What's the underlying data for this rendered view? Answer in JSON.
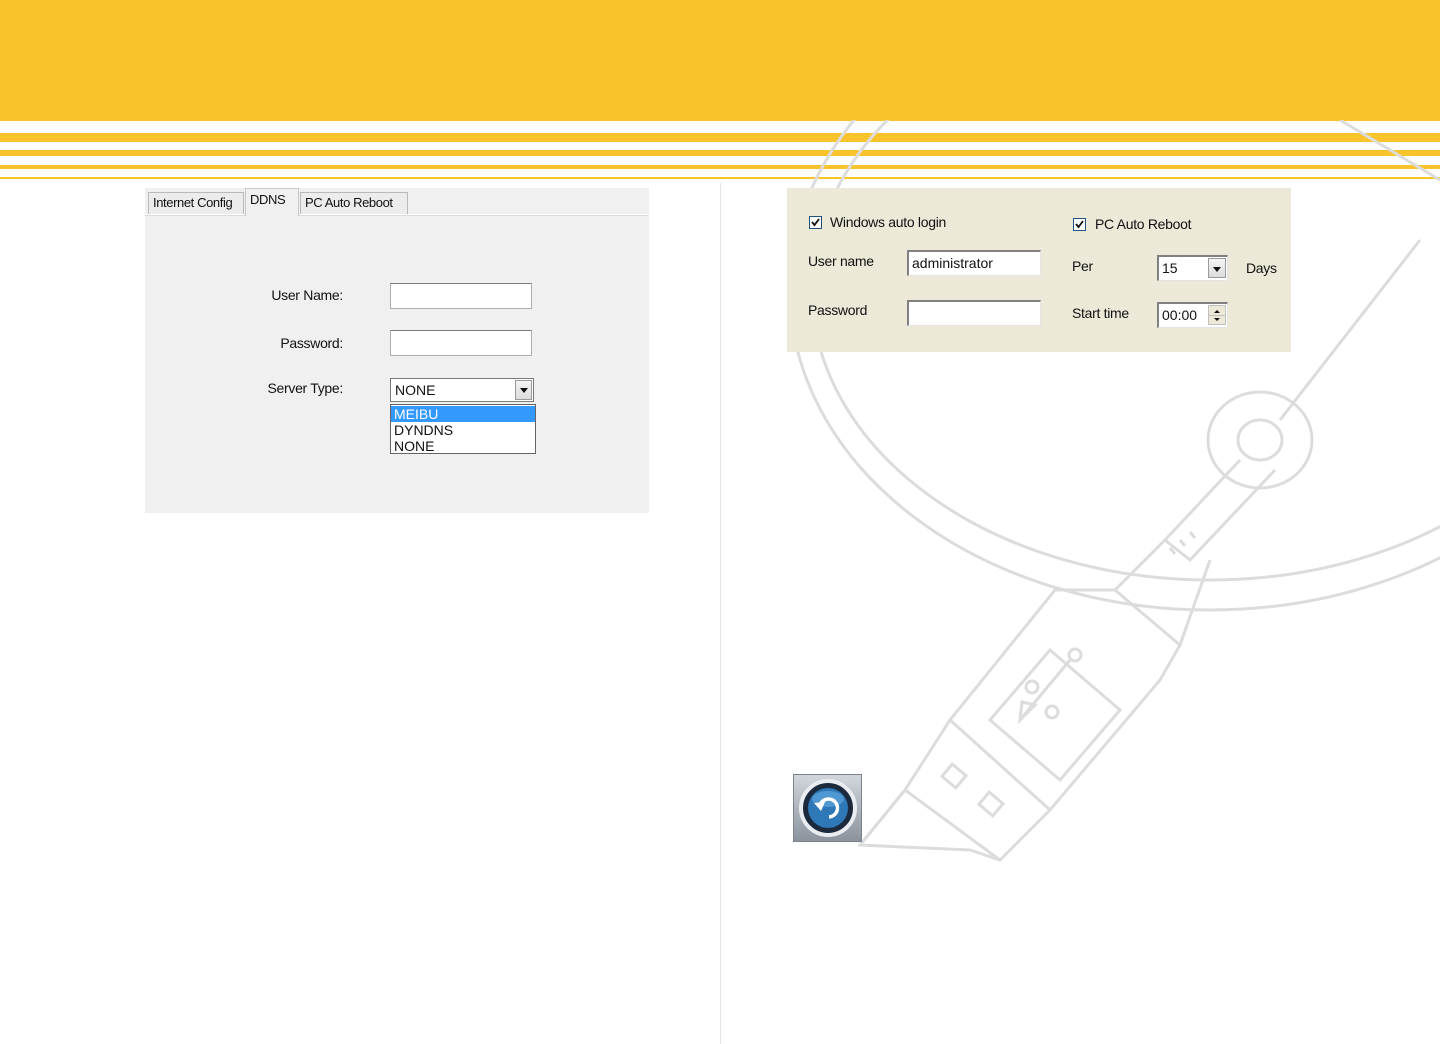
{
  "colors": {
    "banner": "#f9c32c",
    "tab_panel": "#f0f0f0",
    "reboot_panel": "#ece9d8",
    "selection": "#3399ff",
    "deco_stroke": "#dcdcdc"
  },
  "ddns_dialog": {
    "tabs": [
      {
        "label": "Internet Config",
        "active": false
      },
      {
        "label": "DDNS",
        "active": true
      },
      {
        "label": "PC Auto Reboot",
        "active": false
      }
    ],
    "username_label": "User Name:",
    "username_value": "",
    "password_label": "Password:",
    "password_value": "",
    "server_type_label": "Server Type:",
    "server_type_value": "NONE",
    "server_type_options": [
      {
        "label": "MEIBU",
        "highlighted": true
      },
      {
        "label": "DYNDNS",
        "highlighted": false
      },
      {
        "label": "NONE",
        "highlighted": false
      }
    ]
  },
  "reboot_dialog": {
    "auto_login_label": "Windows auto login",
    "auto_login_checked": true,
    "username_label": "User name",
    "username_value": "administrator",
    "password_label": "Password",
    "password_value": "",
    "auto_reboot_label": "PC Auto Reboot",
    "auto_reboot_checked": true,
    "per_label": "Per",
    "per_value": "15",
    "days_label": "Days",
    "start_time_label": "Start time",
    "start_time_value": "00:00"
  },
  "icons": {
    "back": "undo-arrow-icon",
    "decoration": "usb-cable-icon"
  }
}
